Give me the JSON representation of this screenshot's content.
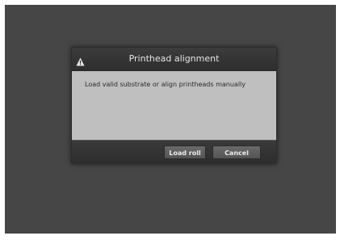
{
  "dialog": {
    "icon": "warning-triangle-icon",
    "title": "Printhead alignment",
    "message": "Load valid substrate or align printheads manually",
    "buttons": {
      "load_roll": "Load roll",
      "cancel": "Cancel"
    }
  },
  "colors": {
    "screen_background": "#464646",
    "dialog_header": "#333333",
    "dialog_body": "#bfbfbf",
    "button": "#5e5e5e"
  }
}
